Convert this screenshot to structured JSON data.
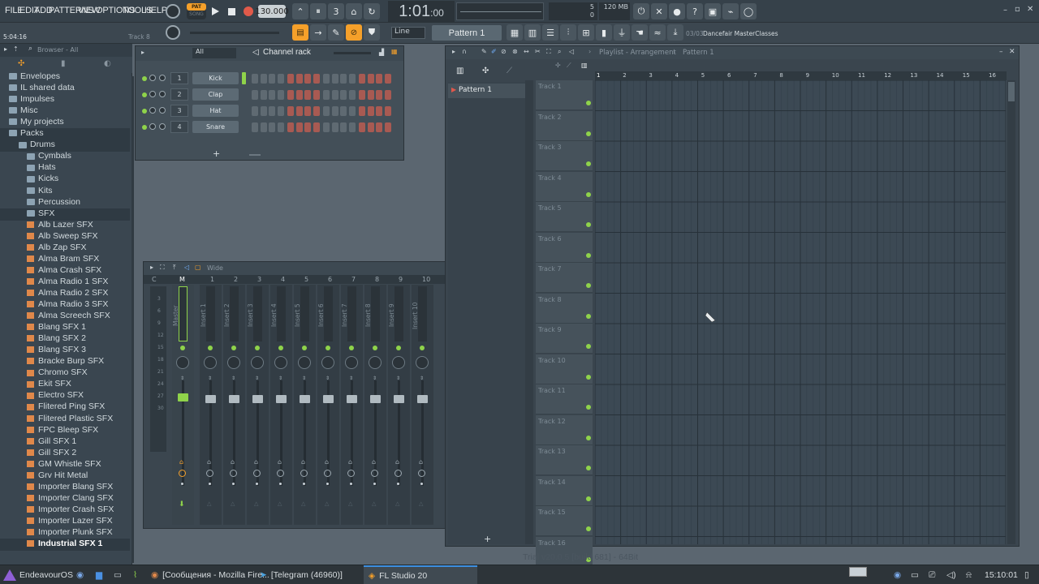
{
  "menu": [
    "FILE",
    "EDIT",
    "ADD",
    "PATTERNS",
    "VIEW",
    "OPTIONS",
    "TOOLS",
    "HELP"
  ],
  "transport": {
    "pat_song_top": "PAT",
    "pat_song_bottom": "SONG",
    "tempo": "130.000",
    "time": "1:01",
    "time_ticks": ":00"
  },
  "monitor": {
    "cpu": "5",
    "mem": "120 MB",
    "poly": "0"
  },
  "hint": {
    "time": "5:04:16",
    "target": "Track 8"
  },
  "row2": {
    "snap": "Line",
    "pattern": "Pattern 1",
    "news_count": "03/03",
    "news": "Dancefair MasterClasses"
  },
  "browser": {
    "title": "Browser - All",
    "items": [
      {
        "label": "Envelopes",
        "kind": "folder",
        "indent": 1
      },
      {
        "label": "IL shared data",
        "kind": "folder",
        "indent": 1
      },
      {
        "label": "Impulses",
        "kind": "folder",
        "indent": 1
      },
      {
        "label": "Misc",
        "kind": "folder",
        "indent": 1
      },
      {
        "label": "My projects",
        "kind": "folder",
        "indent": 1
      },
      {
        "label": "Packs",
        "kind": "folder",
        "indent": 1,
        "open": true
      },
      {
        "label": "Drums",
        "kind": "folder",
        "indent": 2,
        "open": true
      },
      {
        "label": "Cymbals",
        "kind": "folder",
        "indent": 3
      },
      {
        "label": "Hats",
        "kind": "folder",
        "indent": 3
      },
      {
        "label": "Kicks",
        "kind": "folder",
        "indent": 3
      },
      {
        "label": "Kits",
        "kind": "folder",
        "indent": 3
      },
      {
        "label": "Percussion",
        "kind": "folder",
        "indent": 3
      },
      {
        "label": "SFX",
        "kind": "folder",
        "indent": 3,
        "open": true
      },
      {
        "label": "Alb Lazer SFX",
        "kind": "file",
        "indent": 3
      },
      {
        "label": "Alb Sweep SFX",
        "kind": "file",
        "indent": 3
      },
      {
        "label": "Alb Zap SFX",
        "kind": "file",
        "indent": 3
      },
      {
        "label": "Alma Bram SFX",
        "kind": "file",
        "indent": 3
      },
      {
        "label": "Alma Crash SFX",
        "kind": "file",
        "indent": 3
      },
      {
        "label": "Alma Radio 1 SFX",
        "kind": "file",
        "indent": 3
      },
      {
        "label": "Alma Radio 2 SFX",
        "kind": "file",
        "indent": 3
      },
      {
        "label": "Alma Radio 3 SFX",
        "kind": "file",
        "indent": 3
      },
      {
        "label": "Alma Screech SFX",
        "kind": "file",
        "indent": 3
      },
      {
        "label": "Blang SFX 1",
        "kind": "file",
        "indent": 3
      },
      {
        "label": "Blang SFX 2",
        "kind": "file",
        "indent": 3
      },
      {
        "label": "Blang SFX 3",
        "kind": "file",
        "indent": 3
      },
      {
        "label": "Bracke Burp SFX",
        "kind": "file",
        "indent": 3
      },
      {
        "label": "Chromo SFX",
        "kind": "file",
        "indent": 3
      },
      {
        "label": "Ekit SFX",
        "kind": "file",
        "indent": 3
      },
      {
        "label": "Electro SFX",
        "kind": "file",
        "indent": 3
      },
      {
        "label": "Flitered Ping SFX",
        "kind": "file",
        "indent": 3
      },
      {
        "label": "Flitered Plastic SFX",
        "kind": "file",
        "indent": 3
      },
      {
        "label": "FPC Bleep SFX",
        "kind": "file",
        "indent": 3
      },
      {
        "label": "Gill SFX 1",
        "kind": "file",
        "indent": 3
      },
      {
        "label": "Gill SFX 2",
        "kind": "file",
        "indent": 3
      },
      {
        "label": "GM Whistle SFX",
        "kind": "file",
        "indent": 3
      },
      {
        "label": "Grv Hit Metal",
        "kind": "file",
        "indent": 3
      },
      {
        "label": "Importer Blang SFX",
        "kind": "file",
        "indent": 3
      },
      {
        "label": "Importer Clang SFX",
        "kind": "file",
        "indent": 3
      },
      {
        "label": "Importer Crash SFX",
        "kind": "file",
        "indent": 3
      },
      {
        "label": "Importer Lazer SFX",
        "kind": "file",
        "indent": 3
      },
      {
        "label": "Importer Plunk SFX",
        "kind": "file",
        "indent": 3
      },
      {
        "label": "Industrial SFX 1",
        "kind": "file",
        "indent": 3,
        "selected": true
      }
    ]
  },
  "rack": {
    "filter": "All",
    "title": "Channel rack",
    "channels": [
      {
        "num": "1",
        "name": "Kick"
      },
      {
        "num": "2",
        "name": "Clap"
      },
      {
        "num": "3",
        "name": "Hat"
      },
      {
        "num": "4",
        "name": "Snare"
      }
    ],
    "add": "+"
  },
  "mixer": {
    "preset": "Wide",
    "headers": [
      "C",
      "M",
      "1",
      "2",
      "3",
      "4",
      "5",
      "6",
      "7",
      "8",
      "9",
      "10"
    ],
    "strips": [
      "Master",
      "Insert 1",
      "Insert 2",
      "Insert 3",
      "Insert 4",
      "Insert 5",
      "Insert 6",
      "Insert 7",
      "Insert 8",
      "Insert 9",
      "Insert 10"
    ],
    "meter_ticks": [
      "3",
      "6",
      "9",
      "12",
      "15",
      "18",
      "21",
      "24",
      "27",
      "30"
    ]
  },
  "playlist": {
    "breadcrumb": "Playlist - Arrangement",
    "pattern": "Pattern 1",
    "patterns": [
      "Pattern 1"
    ],
    "add": "+",
    "bars": [
      "1",
      "2",
      "3",
      "4",
      "5",
      "6",
      "7",
      "8",
      "9",
      "10",
      "11",
      "12",
      "13",
      "14",
      "15",
      "16"
    ],
    "tracks": [
      "Track 1",
      "Track 2",
      "Track 3",
      "Track 4",
      "Track 5",
      "Track 6",
      "Track 7",
      "Track 8",
      "Track 9",
      "Track 10",
      "Track 11",
      "Track 12",
      "Track 13",
      "Track 14",
      "Track 15",
      "Track 16"
    ]
  },
  "version": "Trial v20.0.5 [build 681] - 64Bit",
  "taskbar": {
    "start": "EndeavourOS",
    "windows": [
      "[Сообщения - Mozilla Fire...",
      "[Telegram (46960)]",
      "FL Studio 20"
    ],
    "clock": "15:10:01"
  },
  "colors": {
    "accent_orange": "#f5a02a",
    "led_green": "#8fd34a",
    "step_red": "#a85a52",
    "step_gray": "#5f6a72"
  }
}
